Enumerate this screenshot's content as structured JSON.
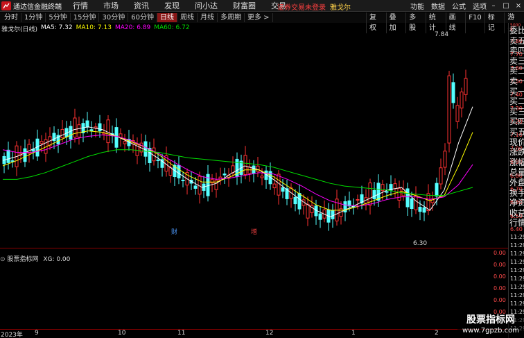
{
  "titlebar": {
    "app_name": "通达信金融终端",
    "menu": [
      "行情",
      "市场",
      "资讯",
      "发现",
      "问小达",
      "财富圈",
      "交易"
    ],
    "notice": "证券交易未登录",
    "stock": "雅戈尔",
    "right_items": [
      "功能",
      "数据",
      "公式",
      "选项"
    ]
  },
  "toolbar": {
    "periods": [
      "分时",
      "1分钟",
      "5分钟",
      "15分钟",
      "30分钟",
      "60分钟",
      "日线",
      "周线",
      "月线",
      "多周期",
      "更多 >"
    ],
    "active_period": "日线",
    "tools": [
      "复权",
      "叠加",
      "多股",
      "统计",
      "画线",
      "F10",
      "标记"
    ],
    "guest": "游客"
  },
  "indicator_line": {
    "title": "雅戈尔(日线)",
    "ma5": "MA5: 7.32",
    "ma10": "MA10: 7.13",
    "ma20": "MA20: 6.89",
    "ma60": "MA60: 6.72"
  },
  "colors": {
    "up": "#ff3232",
    "down": "#54ffff",
    "ma5": "#ffffff",
    "ma10": "#ffff00",
    "ma20": "#ff00ff",
    "ma60": "#00e000",
    "axis_red": "#ff4b4b"
  },
  "side_panel": [
    "委比",
    "卖五",
    "卖四",
    "卖三",
    "卖二",
    "卖一",
    "买一",
    "买二",
    "买三",
    "买四",
    "买五",
    "现价",
    "涨跌",
    "涨幅",
    "总量",
    "外盘",
    "换手",
    "净资",
    "收益",
    "行情"
  ],
  "side_lower_times": [
    "11:29",
    "11:29",
    "11:29",
    "11:29",
    "11:29",
    "11:29",
    "11:29",
    "11:29",
    "11:29",
    "11:29",
    "11:29",
    "11:29"
  ],
  "annotations": {
    "high": "7.84",
    "low": "6.30",
    "event1": "财",
    "event2": "增"
  },
  "lower_indicator": {
    "name": "股票指标网",
    "xg": "XG: 0.00",
    "values": [
      "0.00",
      "0.00",
      "0.00",
      "0.00",
      "0.00",
      "0.00"
    ]
  },
  "xaxis": {
    "labels": [
      "2023年",
      "9",
      "10",
      "11",
      "12",
      "1",
      "2"
    ]
  },
  "watermark": {
    "line1": "股票指标网",
    "line2": "www.7gpzb.com"
  },
  "chart_data": {
    "type": "candlestick",
    "y_ticks": [
      7.8,
      7.7,
      7.6,
      7.5,
      7.4,
      7.3,
      7.2,
      7.1,
      7.0,
      6.9,
      6.8,
      6.7,
      6.6,
      6.5,
      6.4
    ],
    "ylim": [
      6.4,
      7.84
    ],
    "scale_marks": [
      "5000",
      "8"
    ],
    "series_ma": {
      "ma5": [
        6.92,
        6.95,
        7.0,
        7.05,
        7.1,
        7.15,
        7.17,
        7.15,
        7.1,
        7.05,
        7.0,
        6.93,
        6.85,
        6.78,
        6.72,
        6.75,
        6.82,
        6.88,
        6.85,
        6.78,
        6.7,
        6.62,
        6.55,
        6.5,
        6.55,
        6.6,
        6.65,
        6.7,
        6.72,
        6.62,
        6.55,
        6.7,
        7.05,
        7.32
      ],
      "ma10": [
        6.88,
        6.92,
        6.97,
        7.02,
        7.07,
        7.12,
        7.14,
        7.13,
        7.1,
        7.06,
        7.02,
        6.96,
        6.88,
        6.81,
        6.76,
        6.76,
        6.8,
        6.85,
        6.85,
        6.8,
        6.73,
        6.66,
        6.59,
        6.55,
        6.55,
        6.58,
        6.62,
        6.66,
        6.69,
        6.66,
        6.62,
        6.66,
        6.88,
        7.13
      ],
      "ma20": [
        7.0,
        6.98,
        6.98,
        7.0,
        7.04,
        7.08,
        7.1,
        7.11,
        7.1,
        7.07,
        7.02,
        6.97,
        6.91,
        6.85,
        6.8,
        6.78,
        6.79,
        6.81,
        6.83,
        6.82,
        6.78,
        6.73,
        6.67,
        6.62,
        6.59,
        6.58,
        6.6,
        6.63,
        6.65,
        6.65,
        6.63,
        6.65,
        6.74,
        6.89
      ],
      "ma60": [
        6.78,
        6.78,
        6.8,
        6.83,
        6.87,
        6.91,
        6.95,
        6.98,
        7.0,
        7.0,
        6.99,
        6.98,
        6.96,
        6.94,
        6.93,
        6.92,
        6.91,
        6.9,
        6.89,
        6.87,
        6.84,
        6.81,
        6.78,
        6.75,
        6.73,
        6.72,
        6.71,
        6.7,
        6.68,
        6.67,
        6.66,
        6.66,
        6.69,
        6.72
      ]
    }
  }
}
